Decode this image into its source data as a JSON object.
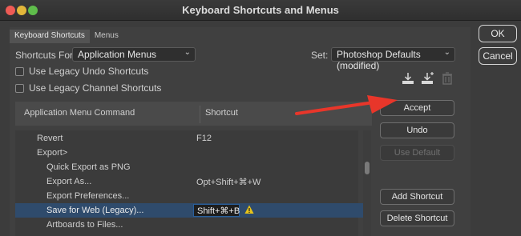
{
  "window": {
    "title": "Keyboard Shortcuts and Menus"
  },
  "tabs": [
    {
      "label": "Keyboard Shortcuts",
      "active": true
    },
    {
      "label": "Menus",
      "active": false
    }
  ],
  "shortcuts_for": {
    "label": "Shortcuts For:",
    "value": "Application Menus"
  },
  "set": {
    "label": "Set:",
    "value": "Photoshop Defaults (modified)"
  },
  "options": {
    "legacy_undo": {
      "label": "Use Legacy Undo Shortcuts",
      "checked": false
    },
    "legacy_channel": {
      "label": "Use Legacy Channel Shortcuts",
      "checked": false
    }
  },
  "table": {
    "headers": {
      "command": "Application Menu Command",
      "shortcut": "Shortcut"
    },
    "rows": [
      {
        "command": "Revert",
        "shortcut": "F12",
        "indent": 1
      },
      {
        "command": "Export>",
        "shortcut": "",
        "indent": 1
      },
      {
        "command": "Quick Export as PNG",
        "shortcut": "",
        "indent": 2
      },
      {
        "command": "Export As...",
        "shortcut": "Opt+Shift+⌘+W",
        "indent": 2
      },
      {
        "command": "Export Preferences...",
        "shortcut": "",
        "indent": 2
      },
      {
        "command": "Save for Web (Legacy)...",
        "shortcut": "Shift+⌘+B",
        "indent": 2,
        "selected": true,
        "warning": true
      },
      {
        "command": "Artboards to Files...",
        "shortcut": "",
        "indent": 2
      }
    ]
  },
  "buttons": {
    "accept": "Accept",
    "undo": "Undo",
    "use_default": "Use Default",
    "add_shortcut": "Add Shortcut",
    "delete_shortcut": "Delete Shortcut",
    "ok": "OK",
    "cancel": "Cancel"
  },
  "colors": {
    "accent_arrow": "#e8362a",
    "selection": "#2f4b6c",
    "warning": "#e6c21a"
  },
  "icons": [
    "save-set-icon",
    "new-set-icon",
    "delete-set-icon",
    "warning-icon",
    "chevron-down-icon"
  ]
}
